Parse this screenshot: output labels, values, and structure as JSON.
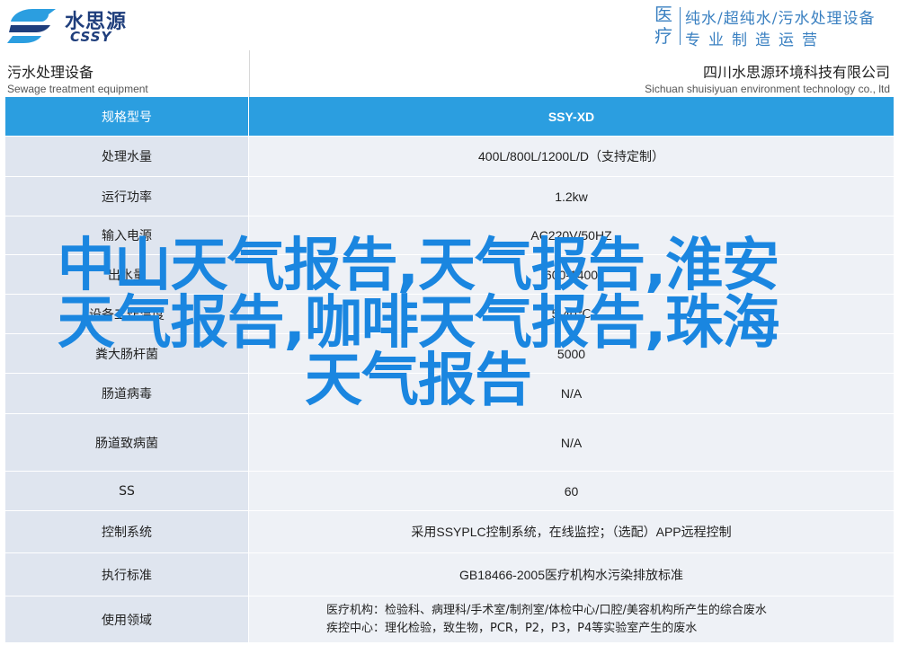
{
  "header": {
    "logo_cn": "水思源",
    "logo_en": "CSSY",
    "slogan_big": "医疗",
    "slogan_line1": "纯水/超纯水/污水处理设备",
    "slogan_line2": "专业制造运营"
  },
  "title": {
    "left_cn": "污水处理设备",
    "left_en": "Sewage treatment equipment",
    "right_cn": "四川水思源环境科技有限公司",
    "right_en": "Sichuan shuisiyuan environment technology co., ltd"
  },
  "table": {
    "rows": [
      {
        "label": "规格型号",
        "value": "SSY-XD"
      },
      {
        "label": "处理水量",
        "value": "400L/800L/1200L/D（支持定制）"
      },
      {
        "label": "运行功率",
        "value": "1.2kw"
      },
      {
        "label": "输入电源",
        "value": "AC220V/50HZ"
      },
      {
        "label": "出水量",
        "value": "600-1400"
      },
      {
        "label": "设备工作温度",
        "value": "5-40℃"
      },
      {
        "label": "粪大肠杆菌",
        "value": "5000"
      },
      {
        "label": "肠道病毒",
        "value": "N/A"
      },
      {
        "label": "肠道致病菌",
        "value": "N/A"
      },
      {
        "label": "SS",
        "value": "60"
      },
      {
        "label": "控制系统",
        "value": "采用SSYPLC控制系统，在线监控；（选配）APP远程控制"
      },
      {
        "label": "执行标准",
        "value": "GB18466-2005医疗机构水污染排放标准"
      },
      {
        "label": "使用领域",
        "value_line1": "医疗机构：检验科、病理科/手术室/制剂室/体检中心/口腔/美容机构所产生的综合废水",
        "value_line2": "疾控中心：理化检验，致生物，PCR，P2，P3，P4等实验室产生的废水"
      }
    ]
  },
  "overlay": {
    "line1": "中山天气报告,天气报告,淮安",
    "line2": "天气报告,咖啡天气报告,珠海",
    "line3": "天气报告"
  },
  "colors": {
    "header_blue": "#2b9ee0",
    "label_bg": "#dfe5ef",
    "value_bg": "#eef1f6",
    "overlay_text": "#1a86e0",
    "brand_navy": "#1f3e7c"
  }
}
